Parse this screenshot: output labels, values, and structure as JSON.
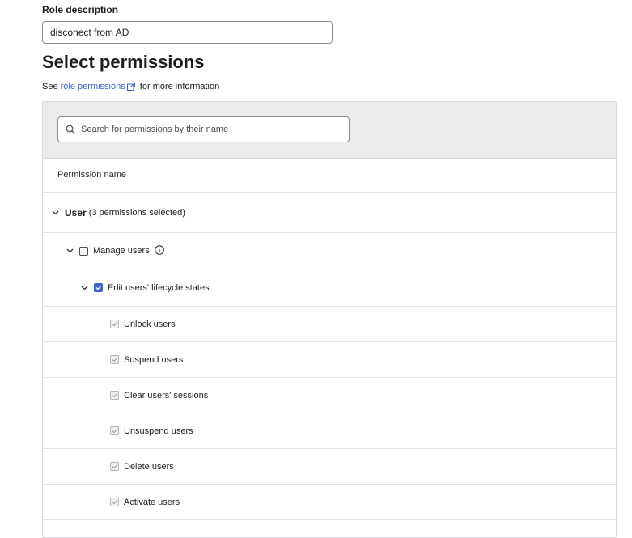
{
  "role": {
    "label": "Role description",
    "value": "disconect from AD"
  },
  "permissions_section": {
    "title": "Select permissions",
    "see_prefix": "See",
    "link_text": "role permissions",
    "see_suffix": "for more information"
  },
  "search": {
    "placeholder": "Search for permissions by their name"
  },
  "table": {
    "column_header": "Permission name",
    "group": {
      "name": "User",
      "summary": "(3 permissions selected)",
      "expanded": true
    },
    "manage_users": {
      "label": "Manage users",
      "checked": false,
      "expanded": true
    },
    "lifecycle": {
      "label": "Edit users' lifecycle states",
      "checked": true,
      "expanded": true
    },
    "sub_permissions": [
      {
        "label": "Unlock users",
        "checked": true,
        "disabled": true
      },
      {
        "label": "Suspend users",
        "checked": true,
        "disabled": true
      },
      {
        "label": "Clear users' sessions",
        "checked": true,
        "disabled": true
      },
      {
        "label": "Unsuspend users",
        "checked": true,
        "disabled": true
      },
      {
        "label": "Delete users",
        "checked": true,
        "disabled": true
      },
      {
        "label": "Activate users",
        "checked": true,
        "disabled": true
      }
    ]
  },
  "colors": {
    "accent": "#3d63d1",
    "panel_header_bg": "#ebebed",
    "border": "#d7d7dc"
  },
  "icons": {
    "external_link": "external-link-icon",
    "search": "search-icon",
    "chevron": "chevron-down-icon",
    "info": "info-icon",
    "check": "check-icon"
  }
}
